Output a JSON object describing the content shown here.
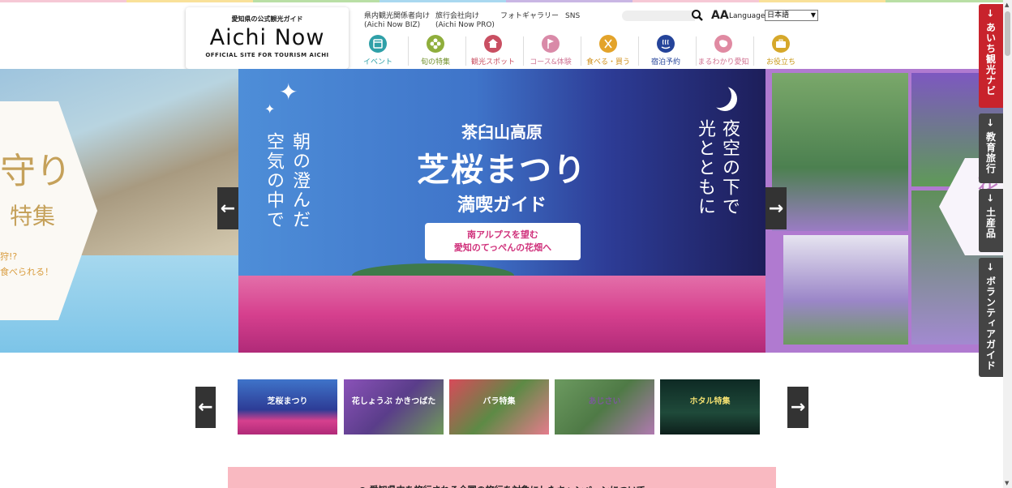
{
  "header": {
    "logo": {
      "subtitle": "愛知県の公式観光ガイド",
      "name": "Aichi Now",
      "tagline": "OFFICIAL SITE FOR TOURISM AICHI"
    },
    "utility_links": [
      {
        "line1": "県内観光関係者向け",
        "line2": "(Aichi Now BIZ)"
      },
      {
        "line1": "旅行会社向け",
        "line2": "(Aichi Now PRO)"
      },
      {
        "line1": "フォトギャラリー",
        "line2": ""
      },
      {
        "line1": "SNS",
        "line2": ""
      }
    ],
    "search": {
      "value": "",
      "icon": "search-icon"
    },
    "font_size_label": "AA",
    "language_label": "Language",
    "language_selected": "日本語"
  },
  "nav": [
    {
      "label": "イベント",
      "icon": "calendar-icon",
      "color": "#2fa0a8"
    },
    {
      "label": "旬の特集",
      "icon": "flower-icon",
      "color": "#8fae3c"
    },
    {
      "label": "観光スポット",
      "icon": "castle-icon",
      "color": "#c94f62"
    },
    {
      "label": "コース&体験",
      "icon": "flag-icon",
      "color": "#d98aa8"
    },
    {
      "label": "食べる・買う",
      "icon": "fork-knife-icon",
      "color": "#e3a32a"
    },
    {
      "label": "宿泊予約",
      "icon": "hot-spring-icon",
      "color": "#25449a"
    },
    {
      "label": "まるわかり愛知",
      "icon": "map-icon",
      "color": "#e08aa2"
    },
    {
      "label": "お役立ち",
      "icon": "briefcase-icon",
      "color": "#d6a82a"
    }
  ],
  "hero": {
    "left_slide": {
      "title_fragment": "守り",
      "subtitle_fragment": "特集",
      "line1": "狩!?",
      "line2": "食べられる！"
    },
    "main_slide": {
      "left_vertical_1": "朝の澄んだ",
      "left_vertical_2": "空気の中で",
      "right_vertical_1": "夜空の下で",
      "right_vertical_2": "光とともに",
      "subtitle": "茶臼山高原",
      "title": "芝桜まつり",
      "guide": "満喫ガイド",
      "ribbon_line1": "南アルプスを望む",
      "ribbon_line2": "愛知のてっぺんの花畑へ"
    },
    "right_slide": {
      "badge_fragment": "花か"
    }
  },
  "thumbnails": [
    {
      "caption": "芝桜まつり",
      "kind": "shibazakura"
    },
    {
      "caption": "花しょうぶ かきつばた",
      "kind": "iris"
    },
    {
      "caption": "バラ特集",
      "kind": "rose"
    },
    {
      "caption": "あじさい",
      "kind": "hydrangea"
    },
    {
      "caption": "ホタル特集",
      "kind": "firefly"
    }
  ],
  "side_tabs": [
    {
      "label": "あいち観光ナビ",
      "color": "#c8232c"
    },
    {
      "label": "教育旅行",
      "color": "#444444"
    },
    {
      "label": "土産品",
      "color": "#444444"
    },
    {
      "label": "ボランティアガイド",
      "color": "#444444"
    }
  ],
  "notice": {
    "text": "● 愛知県内を旅行される全国の旅行を対象にしたキャンペーンについて"
  },
  "colors": {
    "stripe": [
      "#f6c8d5",
      "#f9e199",
      "#b9dfa5",
      "#a9d8f0",
      "#c9b6e4",
      "#f6c8d5",
      "#f9e199",
      "#b9dfa5"
    ]
  }
}
